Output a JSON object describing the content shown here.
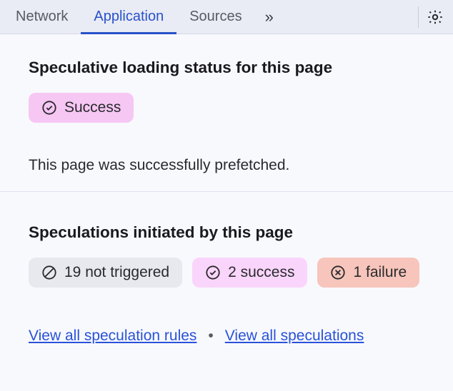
{
  "toolbar": {
    "tabs": [
      "Network",
      "Application",
      "Sources"
    ],
    "active_index": 1,
    "overflow_glyph": "»"
  },
  "panel1": {
    "heading": "Speculative loading status for this page",
    "status_label": "Success",
    "description": "This page was successfully prefetched."
  },
  "panel2": {
    "heading": "Speculations initiated by this page",
    "chips": {
      "not_triggered": "19 not triggered",
      "success": "2 success",
      "failure": "1 failure"
    },
    "link_rules": "View all speculation rules",
    "link_all": "View all speculations",
    "separator": "•"
  }
}
